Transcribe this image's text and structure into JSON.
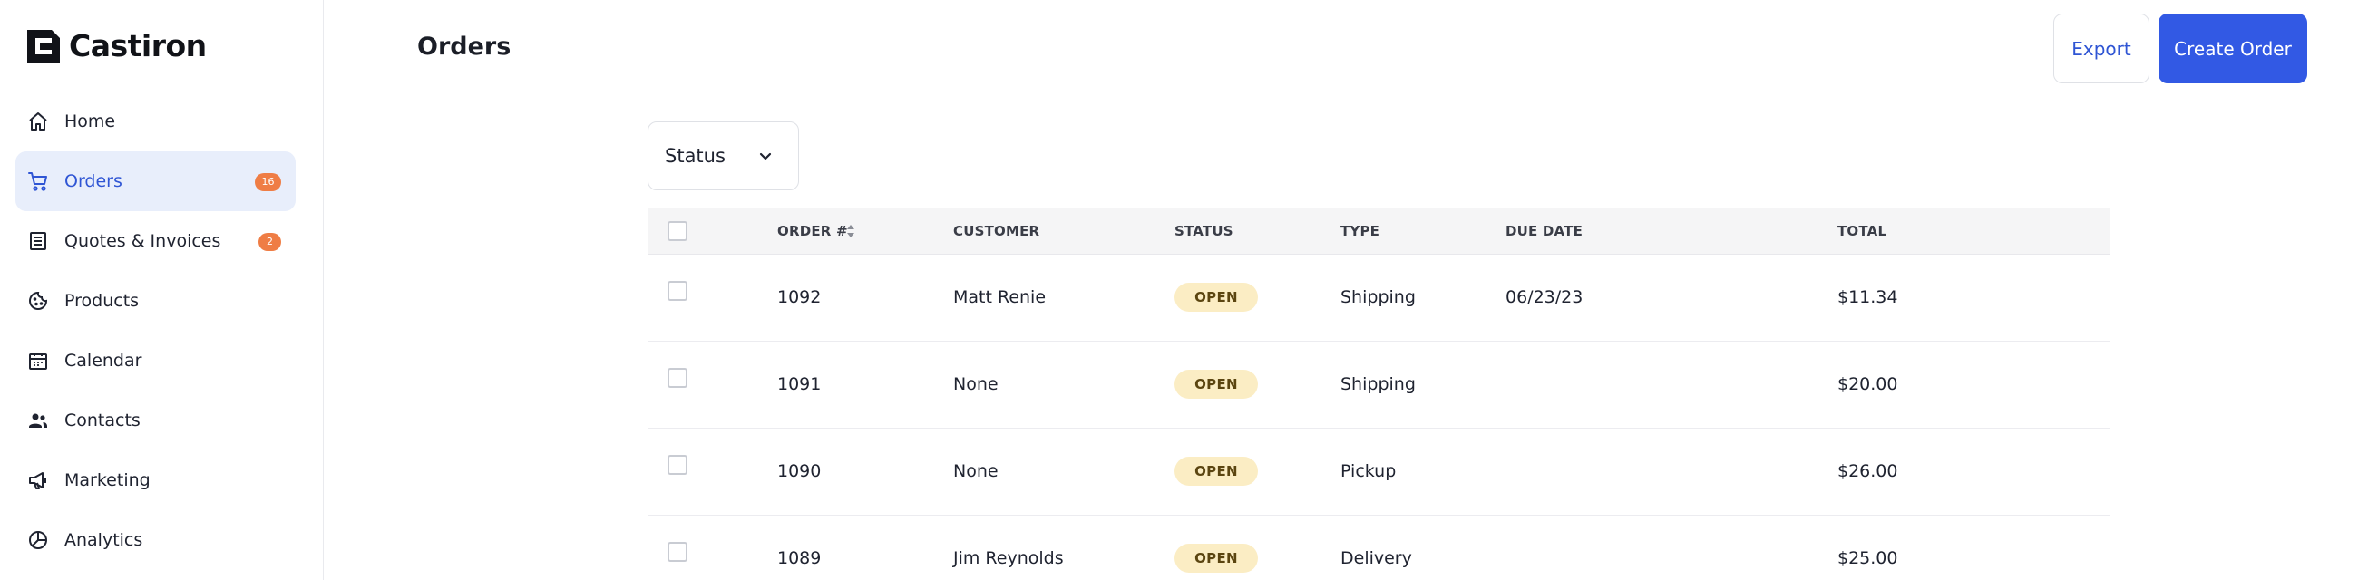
{
  "app": {
    "brand": "Castiron"
  },
  "sidebar": {
    "items": [
      {
        "label": "Home",
        "icon": "home-icon"
      },
      {
        "label": "Orders",
        "icon": "cart-icon",
        "badge": "16",
        "active": true
      },
      {
        "label": "Quotes & Invoices",
        "icon": "document-list-icon",
        "badge": "2"
      },
      {
        "label": "Products",
        "icon": "cookie-icon"
      },
      {
        "label": "Calendar",
        "icon": "calendar-icon"
      },
      {
        "label": "Contacts",
        "icon": "people-icon"
      },
      {
        "label": "Marketing",
        "icon": "megaphone-icon"
      },
      {
        "label": "Analytics",
        "icon": "pie-chart-icon"
      }
    ]
  },
  "header": {
    "title": "Orders",
    "export_label": "Export",
    "create_label": "Create Order"
  },
  "filter": {
    "label": "Status"
  },
  "table": {
    "columns": [
      "ORDER #",
      "CUSTOMER",
      "STATUS",
      "TYPE",
      "DUE DATE",
      "TOTAL"
    ],
    "rows": [
      {
        "order": "1092",
        "customer": "Matt Renie",
        "status": "OPEN",
        "type": "Shipping",
        "due": "06/23/23",
        "total": "$11.34"
      },
      {
        "order": "1091",
        "customer": "None",
        "status": "OPEN",
        "type": "Shipping",
        "due": "",
        "total": "$20.00"
      },
      {
        "order": "1090",
        "customer": "None",
        "status": "OPEN",
        "type": "Pickup",
        "due": "",
        "total": "$26.00"
      },
      {
        "order": "1089",
        "customer": "Jim Reynolds",
        "status": "OPEN",
        "type": "Delivery",
        "due": "",
        "total": "$25.00"
      }
    ]
  },
  "colors": {
    "accent": "#3259e4",
    "active_bg": "#e8eefb",
    "badge": "#ef7d45",
    "status_bg": "#fbedc4"
  }
}
